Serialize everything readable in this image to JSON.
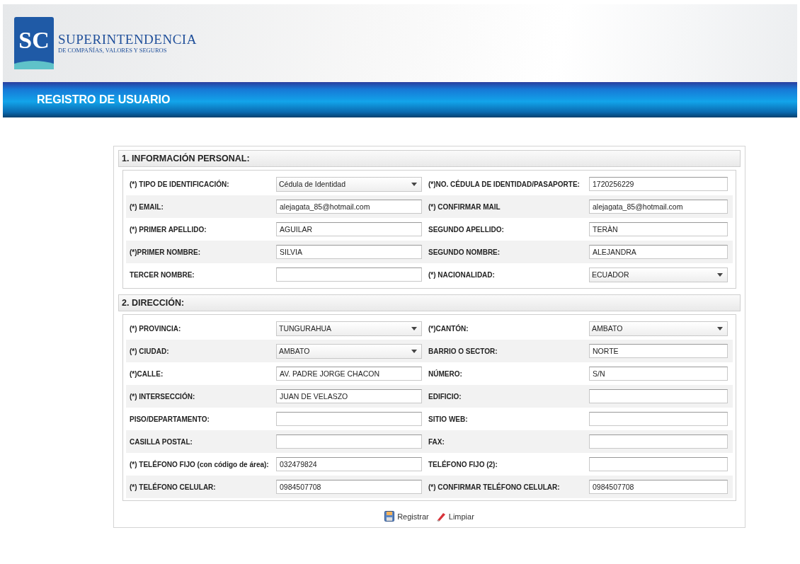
{
  "logo": {
    "letters": "SC",
    "name": "SUPERINTENDENCIA",
    "subtitle": "DE COMPAÑÍAS, VALORES Y SEGUROS"
  },
  "banner": {
    "title": "REGISTRO DE USUARIO"
  },
  "sections": [
    {
      "title": "1. INFORMACIÓN PERSONAL:",
      "rows": [
        [
          {
            "label": "(*) TIPO DE IDENTIFICACIÓN:",
            "kind": "select",
            "value": "Cédula de Identidad"
          },
          {
            "label": "(*)NO. CÉDULA DE IDENTIDAD/PASAPORTE:",
            "kind": "text",
            "value": "1720256229"
          }
        ],
        [
          {
            "label": "(*) EMAIL:",
            "kind": "text",
            "value": "alejagata_85@hotmail.com"
          },
          {
            "label": "(*) CONFIRMAR MAIL",
            "kind": "text",
            "value": "alejagata_85@hotmail.com"
          }
        ],
        [
          {
            "label": "(*) PRIMER APELLIDO:",
            "kind": "text",
            "value": "AGUILAR"
          },
          {
            "label": "SEGUNDO APELLIDO:",
            "kind": "text",
            "value": "TERÀN"
          }
        ],
        [
          {
            "label": "(*)PRIMER NOMBRE:",
            "kind": "text",
            "value": "SILVIA"
          },
          {
            "label": "SEGUNDO NOMBRE:",
            "kind": "text",
            "value": "ALEJANDRA"
          }
        ],
        [
          {
            "label": "TERCER NOMBRE:",
            "kind": "text"
          },
          {
            "label": "(*) NACIONALIDAD:",
            "kind": "select",
            "value": "ECUADOR"
          }
        ]
      ]
    },
    {
      "title": "2. DIRECCIÓN:",
      "rows": [
        [
          {
            "label": "(*) PROVINCIA:",
            "kind": "select",
            "value": "TUNGURAHUA"
          },
          {
            "label": "(*)CANTÓN:",
            "kind": "select",
            "value": "AMBATO"
          }
        ],
        [
          {
            "label": "(*) CIUDAD:",
            "kind": "select",
            "value": "AMBATO"
          },
          {
            "label": "BARRIO O SECTOR:",
            "kind": "text",
            "value": "NORTE"
          }
        ],
        [
          {
            "label": "(*)CALLE:",
            "kind": "text",
            "value": "AV. PADRE JORGE CHACON"
          },
          {
            "label": "NÚMERO:",
            "kind": "text",
            "value": "S/N"
          }
        ],
        [
          {
            "label": "(*) INTERSECCIÓN:",
            "kind": "text",
            "value": "JUAN DE VELASZO"
          },
          {
            "label": "EDIFICIO:",
            "kind": "text"
          }
        ],
        [
          {
            "label": "PISO/DEPARTAMENTO:",
            "kind": "text"
          },
          {
            "label": "SITIO WEB:",
            "kind": "text"
          }
        ],
        [
          {
            "label": "CASILLA POSTAL:",
            "kind": "text"
          },
          {
            "label": "FAX:",
            "kind": "text"
          }
        ],
        [
          {
            "label": "(*) TELÉFONO FIJO (con código de área):",
            "kind": "text",
            "value": "032479824"
          },
          {
            "label": "TELÉFONO FIJO (2):",
            "kind": "text"
          }
        ],
        [
          {
            "label": "(*) TELÉFONO CELULAR:",
            "kind": "text",
            "value": "0984507708"
          },
          {
            "label": "(*) CONFIRMAR TELÉFONO CELULAR:",
            "kind": "text",
            "value": "0984507708"
          }
        ]
      ]
    }
  ],
  "actions": [
    {
      "label": "Registrar",
      "kind": "save"
    },
    {
      "label": "Limpiar",
      "kind": "clear"
    }
  ]
}
